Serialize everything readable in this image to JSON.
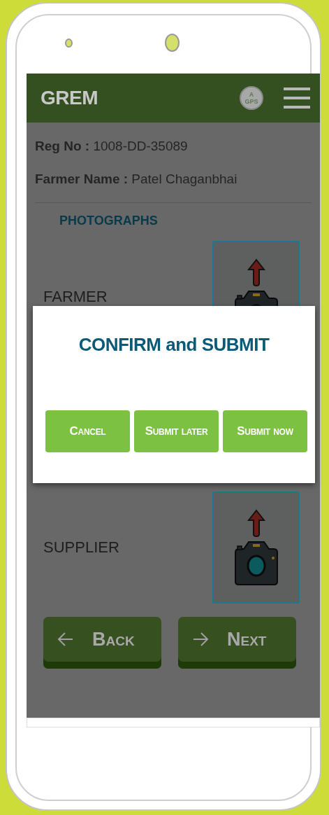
{
  "app_bar": {
    "title": "GREM",
    "gps_badge": [
      "A",
      "GPS"
    ]
  },
  "details": [
    {
      "label": "Reg No :",
      "value": "1008-DD-35089"
    },
    {
      "label": "Farmer Name :",
      "value": "Patel Chaganbhai"
    }
  ],
  "section_title": "PHOTOGRAPHS",
  "photos": [
    {
      "kind": "camera-upload",
      "label": "FARMER"
    },
    {
      "kind": "camera-upload",
      "label": "SUPPLIER"
    }
  ],
  "nav_buttons": [
    {
      "kind": "back",
      "label": "Back"
    },
    {
      "kind": "next",
      "label": "Next"
    }
  ],
  "dialog": {
    "title": "CONFIRM and SUBMIT",
    "buttons": [
      "Cancel",
      "Submit later",
      "Submit now"
    ]
  }
}
